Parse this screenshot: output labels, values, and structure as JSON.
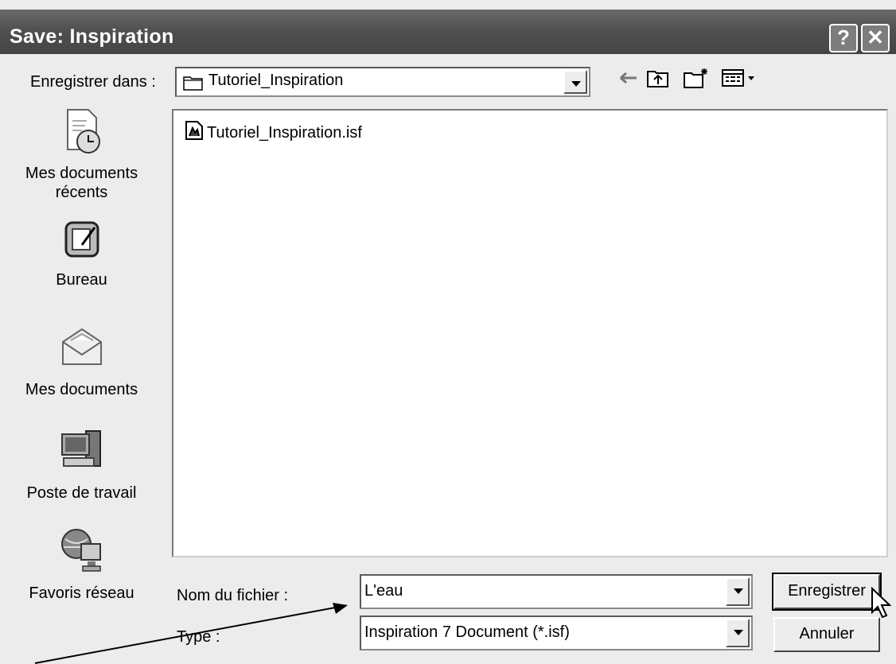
{
  "window": {
    "title": "Save: Inspiration",
    "help_glyph": "?",
    "close_glyph": "✕"
  },
  "lookin": {
    "label": "Enregistrer dans :",
    "value": "Tutoriel_Inspiration"
  },
  "toolbar": {
    "back_icon": "back-arrow-icon",
    "up_icon": "up-folder-icon",
    "newfolder_icon": "new-folder-icon",
    "views_icon": "views-menu-icon"
  },
  "places": [
    {
      "label_line1": "Mes documents",
      "label_line2": "récents",
      "icon": "recent-documents-icon"
    },
    {
      "label_line1": "Bureau",
      "label_line2": "",
      "icon": "desktop-icon"
    },
    {
      "label_line1": "Mes documents",
      "label_line2": "",
      "icon": "my-documents-icon"
    },
    {
      "label_line1": "Poste de travail",
      "label_line2": "",
      "icon": "my-computer-icon"
    },
    {
      "label_line1": "Favoris réseau",
      "label_line2": "",
      "icon": "network-icon"
    }
  ],
  "files": [
    {
      "name": "Tutoriel_Inspiration.isf",
      "icon": "isf-file-icon"
    }
  ],
  "filename": {
    "label": "Nom du fichier :",
    "value": "L'eau"
  },
  "filetype": {
    "label": "Type :",
    "value": "Inspiration 7 Document (*.isf)"
  },
  "buttons": {
    "save": "Enregistrer",
    "cancel": "Annuler"
  }
}
